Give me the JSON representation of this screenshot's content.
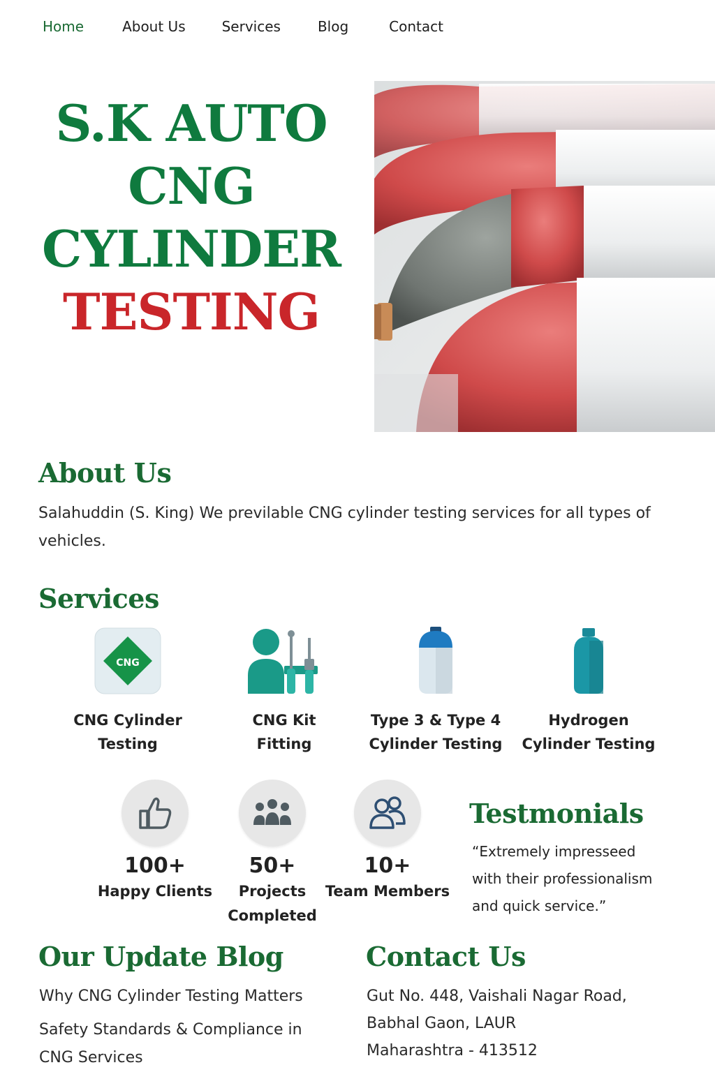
{
  "nav": {
    "items": [
      {
        "label": "Home",
        "active": true
      },
      {
        "label": "About Us"
      },
      {
        "label": "Services"
      },
      {
        "label": "Blog"
      },
      {
        "label": "Contact"
      }
    ]
  },
  "hero": {
    "title_green_lines": [
      "S.K AUTO",
      "CNG",
      "CYLINDER"
    ],
    "title_red_line": "TESTING",
    "image_icon": "cng-cylinders-photo"
  },
  "about": {
    "heading": "About Us",
    "text": "Salahuddin (S. King) We  previlable CNG cylinder testing services for all types of vehicles."
  },
  "services": {
    "heading": "Services",
    "items": [
      {
        "line1": "CNG Cylinder",
        "line2": "Testing",
        "icon": "cng-diamond-icon",
        "badge": "CNG"
      },
      {
        "line1": "CNG Kit",
        "line2": "Fitting",
        "icon": "technician-tools-icon"
      },
      {
        "line1": "Type 3 & Type 4",
        "line2": "Cylinder Testing",
        "icon": "type34-cylinder-icon"
      },
      {
        "line1": "Hydrogen",
        "line2": "Cylinder Testing",
        "icon": "hydrogen-cylinder-icon"
      }
    ]
  },
  "stats": [
    {
      "number": "100+",
      "caption_line1": "Happy Clients",
      "caption_line2": "",
      "icon": "thumbs-up-icon"
    },
    {
      "number": "50+",
      "caption_line1": "Projects",
      "caption_line2": "Completed",
      "icon": "group-icon"
    },
    {
      "number": "10+",
      "caption_line1": "Team Members",
      "caption_line2": "",
      "icon": "team-icon"
    }
  ],
  "testimonials": {
    "heading": "Testmonials",
    "quote_lines": [
      "“Extremely impresseed",
      "with their professionalism",
      "and quick service.”"
    ]
  },
  "blog": {
    "heading": "Our Update Blog",
    "posts": [
      "Why CNG Cylinder Testing Matters",
      "Safety Standards & Compliance in",
      "CNG Services"
    ]
  },
  "contact": {
    "heading": "Contact Us",
    "address_lines": [
      "Gut No. 448, Vaishali Nagar Road,",
      "Babhal Gaon, LAUR",
      "Maharashtra - 413512"
    ]
  },
  "colors": {
    "brand_green": "#0f7a3e",
    "heading_green": "#1a6a33",
    "brand_red": "#c9262a",
    "teal": "#1a9a88"
  }
}
